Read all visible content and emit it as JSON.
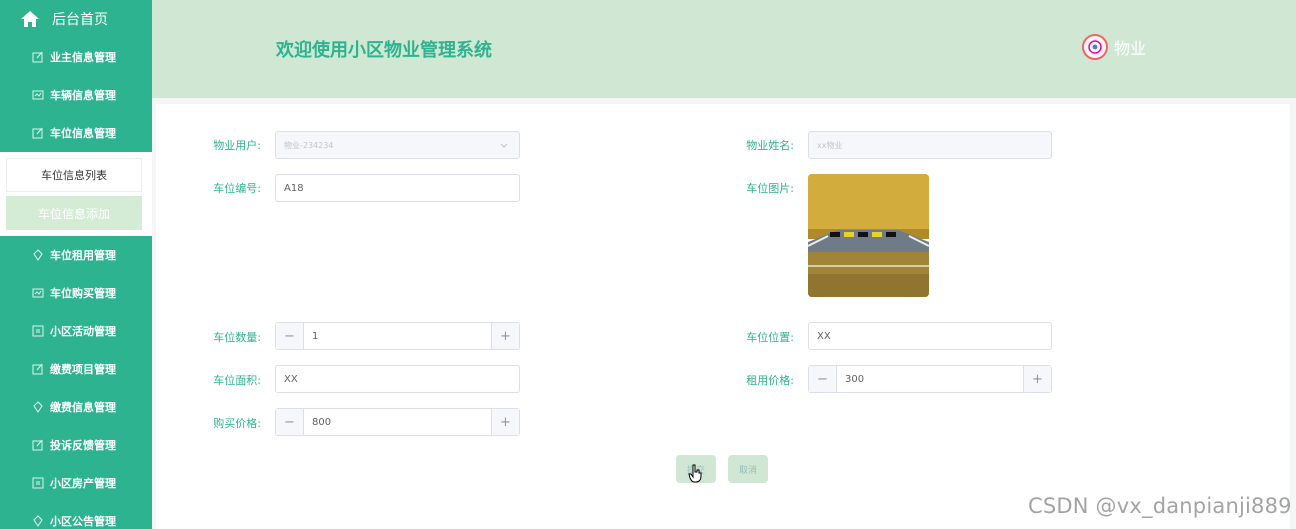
{
  "sidebar": {
    "home_label": "后台首页",
    "items_top": [
      {
        "label": "业主信息管理",
        "icon": "edit-icon"
      },
      {
        "label": "车辆信息管理",
        "icon": "chart-icon"
      },
      {
        "label": "车位信息管理",
        "icon": "edit-icon"
      }
    ],
    "sub": {
      "list_label": "车位信息列表",
      "add_label": "车位信息添加"
    },
    "items_bottom": [
      {
        "label": "车位租用管理",
        "icon": "diamond-icon"
      },
      {
        "label": "车位购买管理",
        "icon": "chart-icon"
      },
      {
        "label": "小区活动管理",
        "icon": "doc-icon"
      },
      {
        "label": "缴费项目管理",
        "icon": "edit-icon"
      },
      {
        "label": "缴费信息管理",
        "icon": "diamond-icon"
      },
      {
        "label": "投诉反馈管理",
        "icon": "edit-icon"
      },
      {
        "label": "小区房产管理",
        "icon": "doc-icon"
      },
      {
        "label": "小区公告管理",
        "icon": "diamond-icon"
      }
    ]
  },
  "header": {
    "title": "欢迎使用小区物业管理系统",
    "user_name": "物业"
  },
  "form": {
    "property_user_label": "物业用户:",
    "property_user_value": "物业-234234",
    "property_name_label": "物业姓名:",
    "property_name_value": "xx物业",
    "space_no_label": "车位编号:",
    "space_no_value": "A18",
    "space_image_label": "车位图片:",
    "space_count_label": "车位数量:",
    "space_count_value": "1",
    "space_location_label": "车位位置:",
    "space_location_value": "XX",
    "space_area_label": "车位面积:",
    "space_area_value": "XX",
    "rent_price_label": "租用价格:",
    "rent_price_value": "300",
    "buy_price_label": "购买价格:",
    "buy_price_value": "800",
    "submit_label": "提交",
    "cancel_label": "取消"
  },
  "watermark": "CSDN @vx_danpianji889",
  "colors": {
    "accent": "#2db38f",
    "header_bg": "#d0e8d3"
  }
}
